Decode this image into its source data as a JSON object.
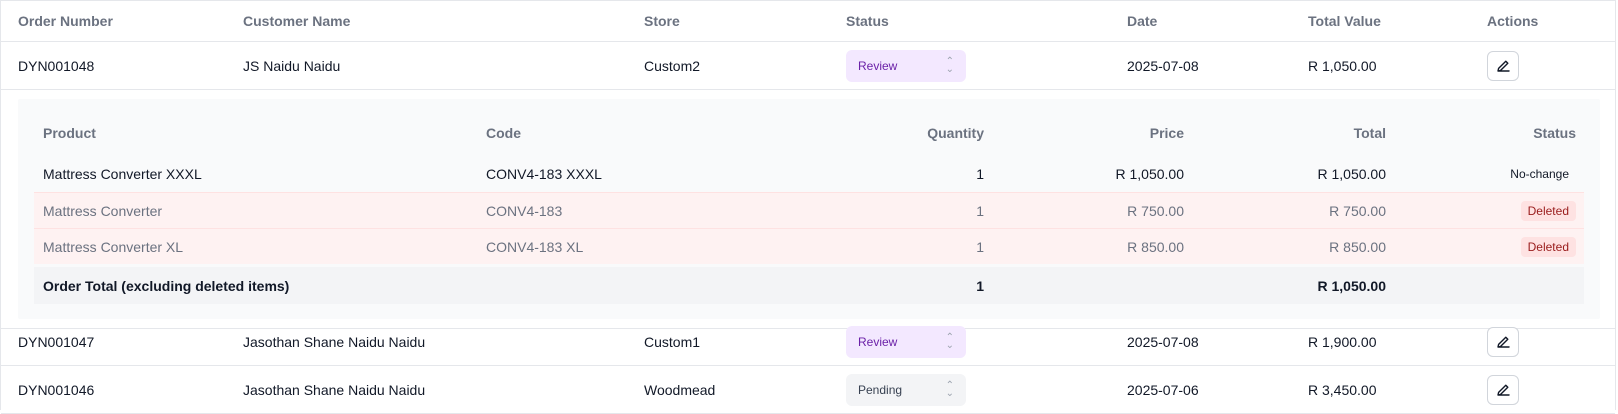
{
  "columns": {
    "order_number": "Order Number",
    "customer_name": "Customer Name",
    "store": "Store",
    "status": "Status",
    "date": "Date",
    "total_value": "Total Value",
    "actions": "Actions"
  },
  "orders": [
    {
      "order_number": "DYN001048",
      "customer_name": "JS Naidu Naidu",
      "store": "Custom2",
      "status": "Review",
      "date": "2025-07-08",
      "total_value": "R 1,050.00"
    },
    {
      "order_number": "DYN001047",
      "customer_name": "Jasothan Shane Naidu Naidu",
      "store": "Custom1",
      "status": "Review",
      "date": "2025-07-08",
      "total_value": "R 1,900.00"
    },
    {
      "order_number": "DYN001046",
      "customer_name": "Jasothan Shane Naidu Naidu",
      "store": "Woodmead",
      "status": "Pending",
      "date": "2025-07-06",
      "total_value": "R 3,450.00"
    }
  ],
  "detail": {
    "columns": {
      "product": "Product",
      "code": "Code",
      "quantity": "Quantity",
      "price": "Price",
      "total": "Total",
      "status": "Status"
    },
    "items": [
      {
        "product": "Mattress Converter XXXL",
        "code": "CONV4-183 XXXL",
        "quantity": "1",
        "price": "R 1,050.00",
        "total": "R 1,050.00",
        "status": "No-change"
      },
      {
        "product": "Mattress Converter",
        "code": "CONV4-183",
        "quantity": "1",
        "price": "R 750.00",
        "total": "R 750.00",
        "status": "Deleted"
      },
      {
        "product": "Mattress Converter XL",
        "code": "CONV4-183 XL",
        "quantity": "1",
        "price": "R 850.00",
        "total": "R 850.00",
        "status": "Deleted"
      }
    ],
    "summary": {
      "label": "Order Total (excluding deleted items)",
      "quantity": "1",
      "total": "R 1,050.00"
    }
  },
  "colors": {
    "review_bg": "#f3e8ff",
    "review_text": "#6b21a8",
    "deleted_bg": "#fef2f2",
    "deleted_badge": "#fee2e2"
  },
  "icons": {
    "edit": "pencil-icon",
    "status_select": "chevron-up-down-icon"
  }
}
